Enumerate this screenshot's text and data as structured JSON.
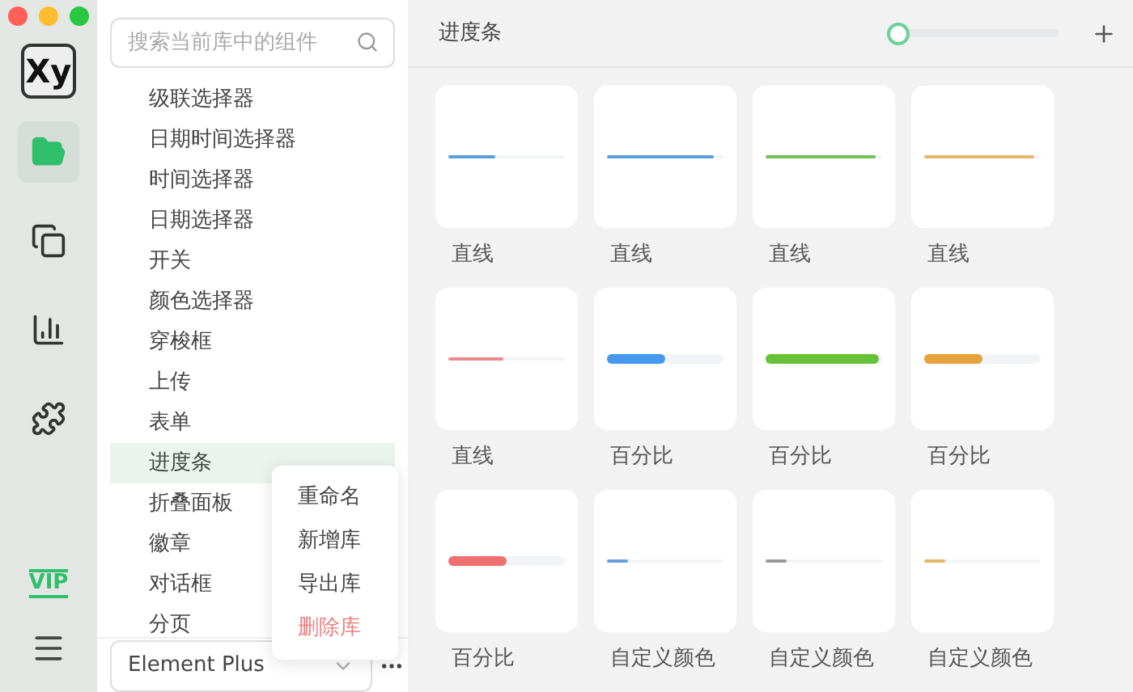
{
  "rail": {
    "logo": "Xy",
    "items": [
      {
        "selected": true
      },
      {
        "selected": false
      },
      {
        "selected": false
      },
      {
        "selected": false
      }
    ],
    "vip": "VIP"
  },
  "sidebar": {
    "search": {
      "placeholder": "搜索当前库中的组件"
    },
    "items": [
      {
        "label": "级联选择器",
        "selected": false
      },
      {
        "label": "日期时间选择器",
        "selected": false
      },
      {
        "label": "时间选择器",
        "selected": false
      },
      {
        "label": "日期选择器",
        "selected": false
      },
      {
        "label": "开关",
        "selected": false
      },
      {
        "label": "颜色选择器",
        "selected": false
      },
      {
        "label": "穿梭框",
        "selected": false
      },
      {
        "label": "上传",
        "selected": false
      },
      {
        "label": "表单",
        "selected": false
      },
      {
        "label": "进度条",
        "selected": true
      },
      {
        "label": "折叠面板",
        "selected": false
      },
      {
        "label": "徽章",
        "selected": false
      },
      {
        "label": "对话框",
        "selected": false
      },
      {
        "label": "分页",
        "selected": false
      }
    ],
    "library": "Element Plus",
    "menu": [
      {
        "label": "重命名",
        "kind": "normal"
      },
      {
        "label": "新增库",
        "kind": "normal"
      },
      {
        "label": "导出库",
        "kind": "normal"
      },
      {
        "label": "删除库",
        "kind": "danger"
      }
    ]
  },
  "main": {
    "title": "进度条",
    "zoom": {
      "level": 0.0
    },
    "cards": [
      {
        "label": "直线",
        "kind": "line",
        "color": "#5a9fd8",
        "level": 0.4
      },
      {
        "label": "直线",
        "kind": "line",
        "color": "#5a9fd8",
        "level": 0.92
      },
      {
        "label": "直线",
        "kind": "line",
        "color": "#76c05a",
        "level": 0.94
      },
      {
        "label": "直线",
        "kind": "line",
        "color": "#e5b66a",
        "level": 0.94
      },
      {
        "label": "直线",
        "kind": "line",
        "color": "#ec8a8a",
        "level": 0.47
      },
      {
        "label": "百分比",
        "kind": "thick",
        "color": "#4499ee",
        "level": 0.5
      },
      {
        "label": "百分比",
        "kind": "thick",
        "color": "#67c23a",
        "level": 0.97
      },
      {
        "label": "百分比",
        "kind": "thick",
        "color": "#e6a23c",
        "level": 0.5
      },
      {
        "label": "百分比",
        "kind": "thick",
        "color": "#f07070",
        "level": 0.5
      },
      {
        "label": "自定义颜色",
        "kind": "line",
        "color": "#6a9de0",
        "level": 0.18
      },
      {
        "label": "自定义颜色",
        "kind": "line",
        "color": "#999999",
        "level": 0.18
      },
      {
        "label": "自定义颜色",
        "kind": "line",
        "color": "#e5b66a",
        "level": 0.18
      }
    ]
  }
}
